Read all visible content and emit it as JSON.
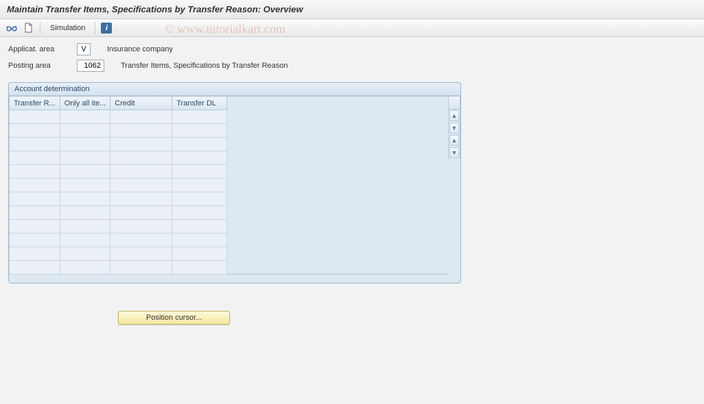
{
  "title": "Maintain Transfer Items, Specifications by Transfer Reason: Overview",
  "toolbar": {
    "simulation_label": "Simulation"
  },
  "form": {
    "applic_area_label": "Applicat. area",
    "applic_area_value": "V",
    "applic_area_desc": "Insurance company",
    "posting_area_label": "Posting area",
    "posting_area_value": "1062",
    "posting_area_desc": "Transfer Items, Specifications by Transfer Reason"
  },
  "panel": {
    "title": "Account determination",
    "columns": [
      "Transfer R...",
      "Only all ite...",
      "Credit",
      "Transfer DL"
    ],
    "row_count": 12
  },
  "buttons": {
    "position_cursor": "Position cursor..."
  },
  "watermark": "© www.tutorialkart.com"
}
